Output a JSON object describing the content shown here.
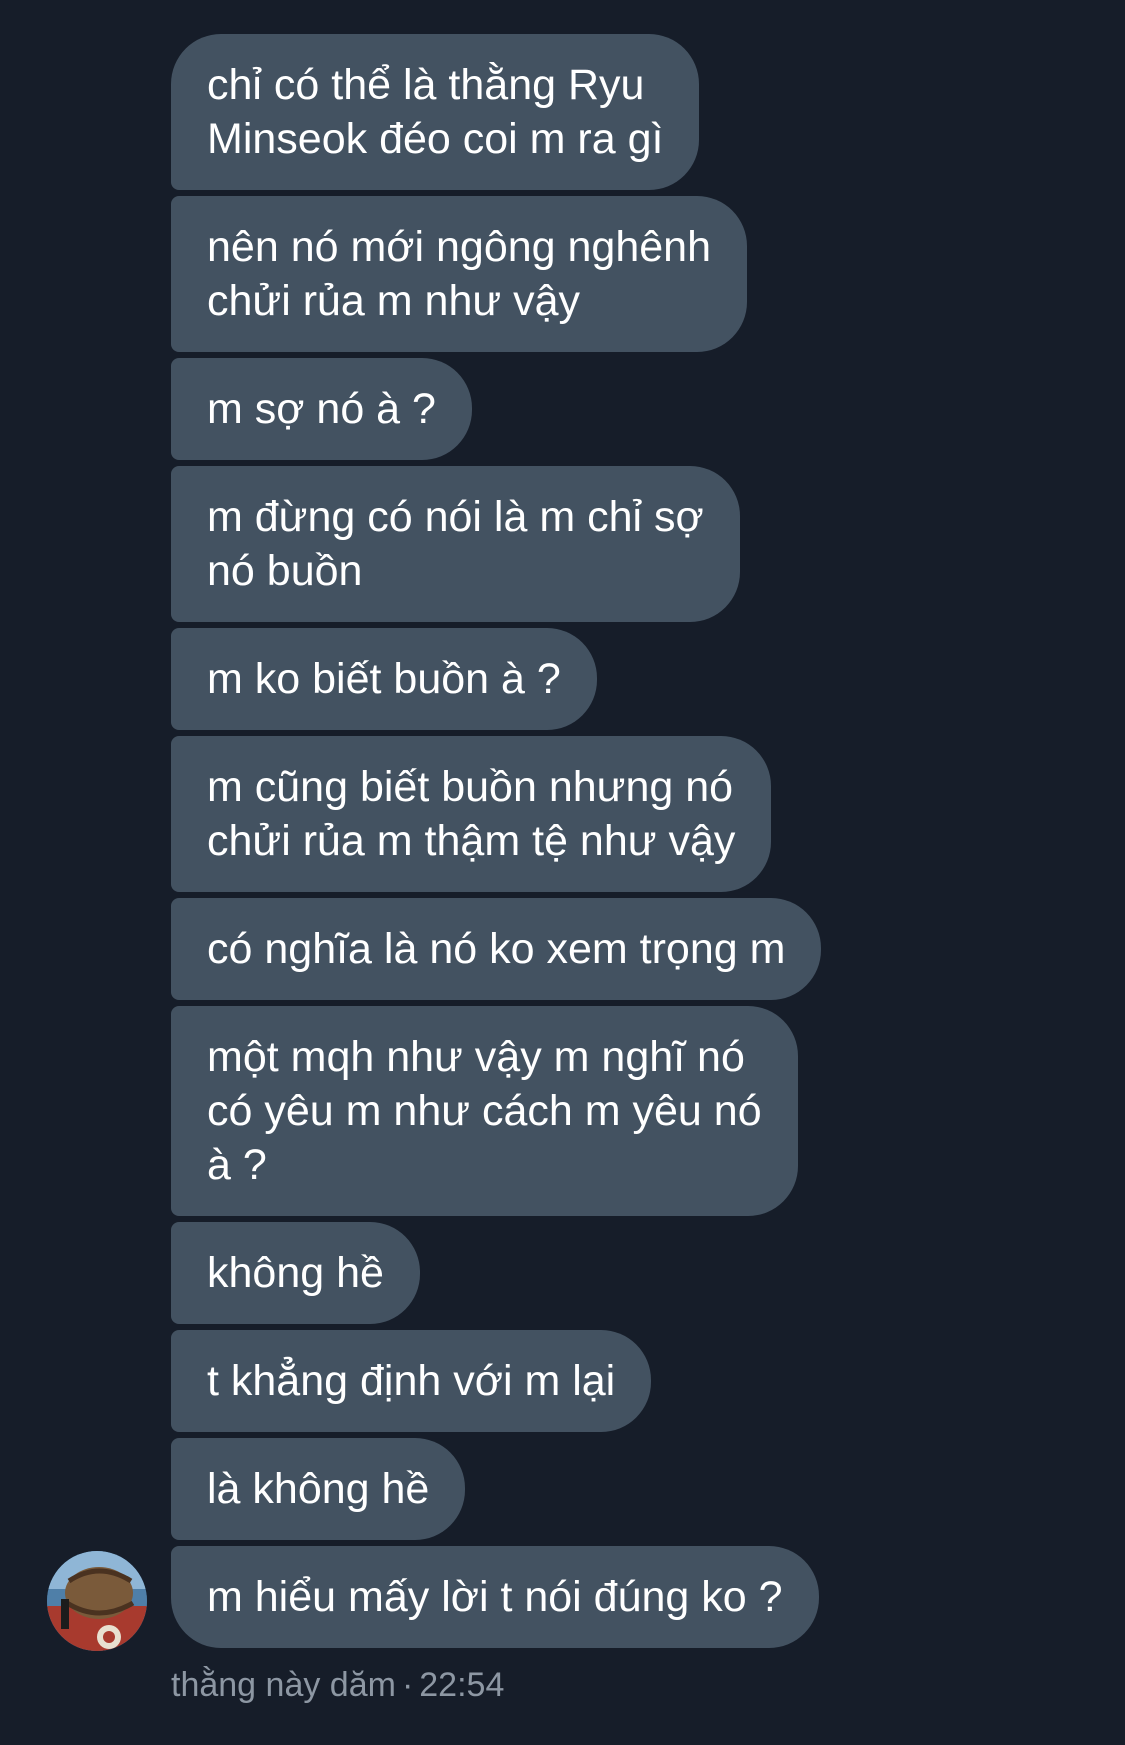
{
  "messages": [
    {
      "text": "chỉ có thể là thằng Ryu\nMinseok đéo coi m ra gì"
    },
    {
      "text": "nên nó mới ngông nghênh\nchửi rủa m như vậy"
    },
    {
      "text": "m sợ nó à ?"
    },
    {
      "text": "m đừng có nói là m chỉ sợ\nnó buồn"
    },
    {
      "text": "m ko biết buồn à ?"
    },
    {
      "text": "m cũng biết buồn nhưng nó\nchửi rủa m thậm tệ như vậy"
    },
    {
      "text": "có nghĩa là nó ko xem trọng m"
    },
    {
      "text": "một mqh như vậy m nghĩ nó\ncó yêu m như cách m yêu nó\nà ?"
    },
    {
      "text": "không hề"
    },
    {
      "text": "t khẳng định với m lại"
    },
    {
      "text": "là không hề"
    },
    {
      "text": "m hiểu mấy lời t nói đúng ko ?"
    }
  ],
  "footer": {
    "sender": "thằng này dăm",
    "separator": "·",
    "time": "22:54"
  },
  "colors": {
    "background": "#161d29",
    "bubble": "#435261",
    "text": "#ffffff",
    "meta": "#8d97a3"
  }
}
